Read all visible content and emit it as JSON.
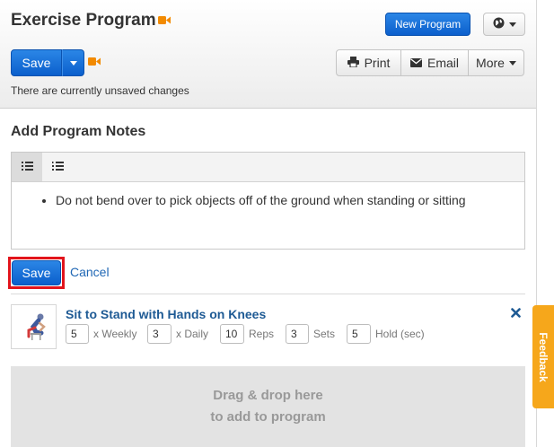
{
  "header": {
    "title": "Exercise Program",
    "new_program_label": "New Program",
    "save_label": "Save",
    "print_label": "Print",
    "email_label": "Email",
    "more_label": "More",
    "status_text": "There are currently unsaved changes"
  },
  "notes": {
    "section_title": "Add Program Notes",
    "items": [
      "Do not bend over to pick objects off of the ground when standing or sitting"
    ],
    "save_label": "Save",
    "cancel_label": "Cancel"
  },
  "exercise": {
    "title": "Sit to Stand with Hands on Knees",
    "params": [
      {
        "value": "5",
        "label": "x Weekly"
      },
      {
        "value": "3",
        "label": "x Daily"
      },
      {
        "value": "10",
        "label": "Reps"
      },
      {
        "value": "3",
        "label": "Sets"
      },
      {
        "value": "5",
        "label": "Hold (sec)"
      }
    ]
  },
  "dropzone": {
    "line1": "Drag & drop here",
    "line2": "to add to program"
  },
  "feedback_label": "Feedback",
  "colors": {
    "primary": "#0b5fcc",
    "video_icon": "#f28a00",
    "highlight": "#e2141c",
    "feedback": "#f6a71b"
  },
  "icons": [
    "video-icon",
    "globe-icon",
    "print-icon",
    "email-icon",
    "list-icon",
    "ordered-list-icon",
    "remove-icon"
  ]
}
